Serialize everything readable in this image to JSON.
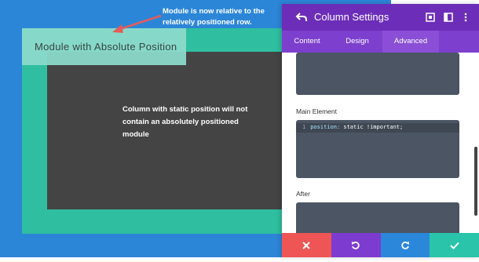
{
  "canvas": {
    "module_label": "Module with Absolute Position",
    "column_text": "Column with static position will not contain an absolutely positioned module",
    "annotation": "Module is now relative to the relatively positioned row."
  },
  "panel": {
    "title": "Column Settings",
    "tabs": [
      {
        "label": "Content",
        "active": false
      },
      {
        "label": "Design",
        "active": false
      },
      {
        "label": "Advanced",
        "active": true
      }
    ],
    "sections": {
      "main_element_label": "Main Element",
      "after_label": "After"
    },
    "code": {
      "line_number": "1",
      "property": "position:",
      "value": "static !important;"
    },
    "footer": [
      {
        "name": "discard-button",
        "icon": "close-icon",
        "color": "#ef5555"
      },
      {
        "name": "undo-button",
        "icon": "undo-icon",
        "color": "#7e3bd0"
      },
      {
        "name": "redo-button",
        "icon": "redo-icon",
        "color": "#2b87da"
      },
      {
        "name": "save-button",
        "icon": "check-icon",
        "color": "#29c4a9"
      }
    ]
  },
  "colors": {
    "canvas_blue": "#2c86d8",
    "row_teal": "#2fbfa0",
    "column_dark": "#444444",
    "header_purple": "#6c2eb9",
    "annotation_arrow": "#e35d5b"
  }
}
